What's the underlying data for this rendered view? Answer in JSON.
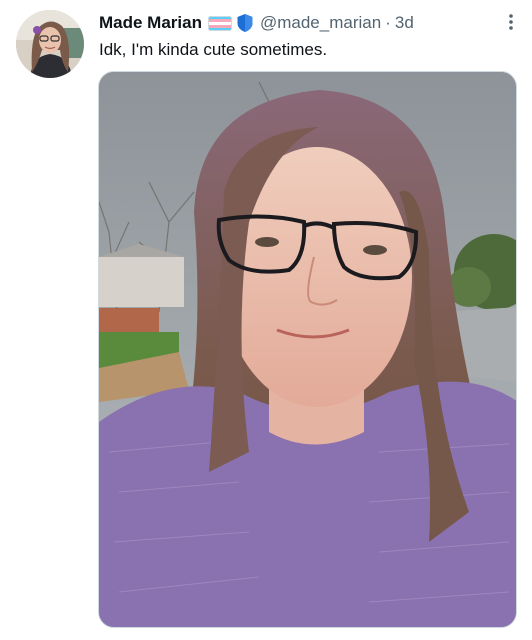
{
  "tweet": {
    "display_name": "Made Marian",
    "handle": "@made_marian",
    "separator": "·",
    "time": "3d",
    "text": "Idk, I'm kinda cute sometimes."
  },
  "icons": {
    "flag": "transgender-flag-icon",
    "shield": "shield-icon",
    "more": "more-options-icon"
  },
  "colors": {
    "name": "#0f1419",
    "secondary": "#536471",
    "flag_blue": "#5bcefa",
    "flag_pink": "#f5a9b8",
    "flag_white": "#ffffff",
    "shield_blue": "#1d6fd6",
    "sweater": "#8a72b0"
  }
}
